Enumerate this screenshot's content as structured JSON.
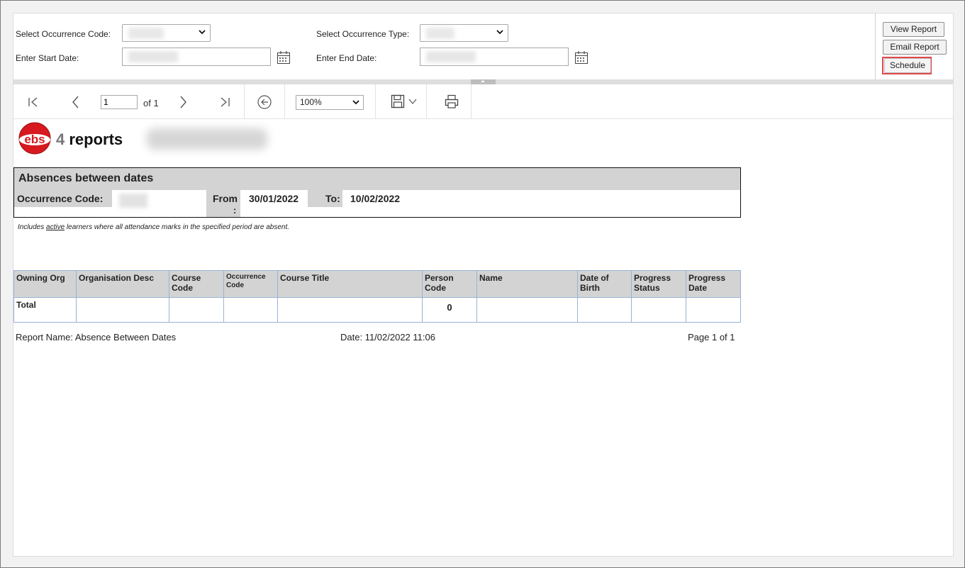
{
  "params": {
    "occurrence_code_label": "Select Occurrence Code:",
    "occurrence_type_label": "Select Occurrence Type:",
    "start_date_label": "Enter Start Date:",
    "end_date_label": "Enter End Date:"
  },
  "actions": {
    "view_report": "View Report",
    "email_report": "Email Report",
    "schedule": "Schedule"
  },
  "toolbar": {
    "page_value": "1",
    "page_of": "of 1",
    "zoom_value": "100%"
  },
  "report": {
    "logo_badge": "ebs",
    "logo_number": "4",
    "logo_word": "reports",
    "title": "Absences between dates",
    "occurrence_code_label": "Occurrence Code:",
    "from_label": "From",
    "from_colon": ":",
    "from_value": "30/01/2022",
    "to_label": "To:",
    "to_value": "10/02/2022",
    "note_pre": "Includes ",
    "note_emph": "active",
    "note_post": " learners where all attendance marks in the specified period are absent.",
    "columns": {
      "owning_org": "Owning Org",
      "org_desc": "Organisation Desc",
      "course_code_1": "Course",
      "course_code_2": "Code",
      "occ_code_1": "Occurrence",
      "occ_code_2": "Code",
      "course_title": "Course Title",
      "person_code_1": "Person",
      "person_code_2": "Code",
      "name": "Name",
      "dob_1": "Date of",
      "dob_2": "Birth",
      "prog_status_1": "Progress",
      "prog_status_2": "Status",
      "prog_date_1": "Progress",
      "prog_date_2": "Date"
    },
    "total_label": "Total",
    "total_count": "0",
    "footer_name": "Report Name: Absence Between Dates",
    "footer_date": "Date: 11/02/2022 11:06",
    "footer_page": "Page 1 of 1"
  },
  "colors": {
    "highlight": "#e0474c",
    "logo_red": "#d71920",
    "header_grey": "#d3d3d3",
    "grid_border": "#9ab0d6"
  },
  "icons": [
    "chevron-down-icon",
    "calendar-icon",
    "first-page-icon",
    "previous-page-icon",
    "next-page-icon",
    "last-page-icon",
    "back-icon",
    "save-icon",
    "print-icon"
  ]
}
